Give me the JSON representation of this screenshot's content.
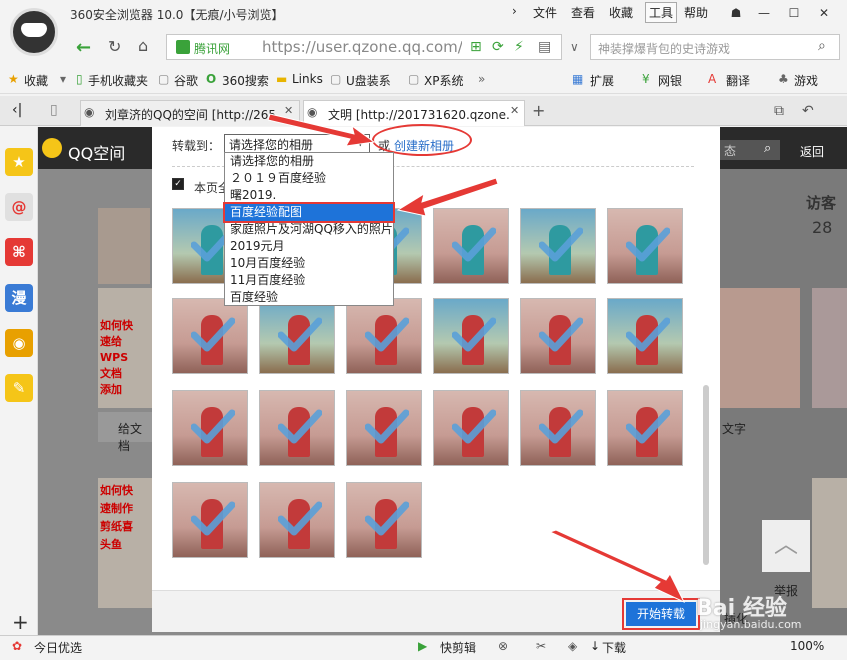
{
  "window": {
    "title": "360安全浏览器 10.0【无痕/小号浏览】",
    "menus": [
      "文件",
      "查看",
      "收藏",
      "工具",
      "帮助"
    ]
  },
  "address": {
    "badge": "腾讯网",
    "url": "https://user.qzone.qq.com/201731",
    "search_placeholder": "神装撑爆背包的史诗游戏"
  },
  "favorites": {
    "items": [
      "收藏",
      "手机收藏夹",
      "谷歌",
      "360搜索",
      "Links",
      "U盘装系",
      "XP系统"
    ],
    "right": [
      "扩展",
      "网银",
      "翻译",
      "游戏"
    ]
  },
  "tabs": [
    {
      "label": "刘章济的QQ的空间 [http://265"
    },
    {
      "label": "文明 [http://201731620.qzone."
    }
  ],
  "sidebar": {
    "icons": [
      "★",
      "@",
      "⌘",
      "漫",
      "◉",
      "✎"
    ]
  },
  "qzone": {
    "brand": "QQ空间",
    "search_hint": "态",
    "back": "返回",
    "visitors": "访客",
    "visitor_count": "28"
  },
  "modal": {
    "transfer_label": "转载到：",
    "select_value": "请选择您的相册",
    "or": "或",
    "create_album": "创建新相册",
    "select_all": "本页全",
    "start_button": "开始转载"
  },
  "dropdown": {
    "options": [
      "请选择您的相册",
      "２０１９百度经验",
      "曙2019.",
      "百度经验配图",
      "家庭照片及河湖QQ移入的照片",
      "2019元月",
      "10月百度经验",
      "11月百度经验",
      "百度经验"
    ],
    "selected_index": 3
  },
  "bg_labels": {
    "left_text": [
      "如何快",
      "速给",
      "WPS",
      "文档",
      "添加"
    ],
    "left_text2": [
      "如何快",
      "速制作",
      "剪纸喜",
      "头鱼"
    ],
    "caption_left": "给文档",
    "caption_right": "文字",
    "caption_right2": "插化",
    "report": "举报"
  },
  "status": {
    "left": "今日优选",
    "items": [
      "快剪辑",
      "下载"
    ],
    "zoom": "100%"
  },
  "watermark": {
    "text": "Bai 经验",
    "url": "jingyan.baidu.com"
  },
  "colors": {
    "accent": "#1e73d9",
    "red": "#e53935",
    "green": "#3aa23a"
  }
}
